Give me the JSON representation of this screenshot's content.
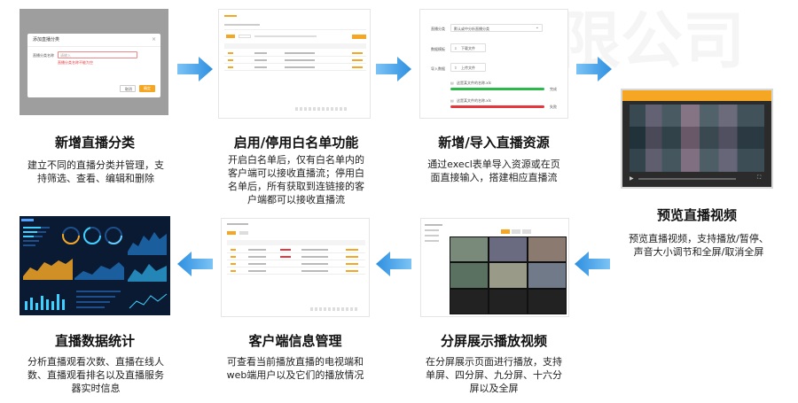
{
  "watermark": "有限公司",
  "sections": [
    {
      "title": "新增直播分类",
      "desc_lines": [
        "建立不同的直播分类并管理，支",
        "持筛选、查看、编辑和删除"
      ]
    },
    {
      "title": "启用/停用白名单功能",
      "desc_lines": [
        "开启白名单后，仅有白名单内的",
        "客户端可以接收直播流；停用白",
        "名单后，所有获取到连链接的客",
        "户端都可以接收直播流"
      ]
    },
    {
      "title": "新增/导入直播资源",
      "desc_lines": [
        "通过execl表单导入资源或在页",
        "面直接输入，搭建相应直播流"
      ]
    },
    {
      "title": "预览直播视频",
      "desc_lines": [
        "预览直播视频，支持播放/暂停、",
        "声音大小调节和全屏/取消全屏"
      ]
    },
    {
      "title": "分屏展示播放视频",
      "desc_lines": [
        "在分屏展示页面进行播放，支持",
        "单屏、四分屏、九分屏、十六分",
        "屏以及全屏"
      ]
    },
    {
      "title": "客户端信息管理",
      "desc_lines": [
        "可查看当前播放直播的电视端和",
        "web端用户以及它们的播放情况"
      ]
    },
    {
      "title": "直播数据统计",
      "desc_lines": [
        "分析直播观看次数、直播在线人",
        "数、直播观看排名以及直播服务",
        "器实时信息"
      ]
    }
  ],
  "thumb_dialog": {
    "title": "添加直播分类",
    "field_label": "直播分类名称",
    "input_placeholder": "请输入",
    "error_text": "直播分类名称不能为空",
    "cancel_label": "取消",
    "ok_label": "确定"
  },
  "thumb_import": {
    "category_label": "直播分类",
    "category_value": "默认或中分析直播分类",
    "template_label": "数据模板",
    "download_label": "下载文件",
    "import_label": "导入数据",
    "upload_label": "上传文件",
    "file1": "这是某文件的名称.xls",
    "file1_status": "完成",
    "file2": "这是某文件的名称.xls",
    "file2_status": "失败"
  },
  "colors": {
    "arrow": "#2e8fe0",
    "accent_orange": "#f5a623",
    "progress_green": "#2db84d",
    "progress_red": "#e5373d",
    "dashboard_bg": "#0b1a33"
  }
}
